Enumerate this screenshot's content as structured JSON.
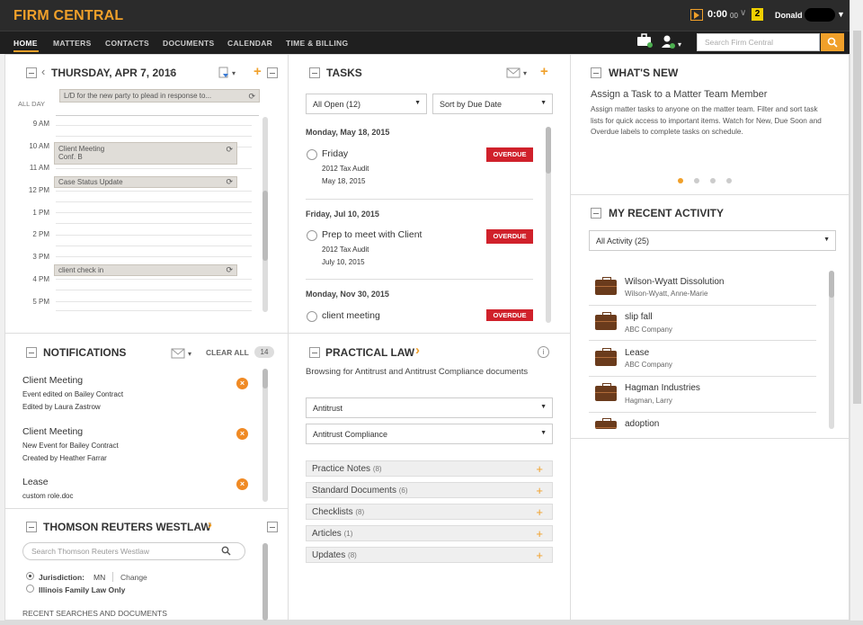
{
  "brand": "FIRM CENTRAL",
  "topbar": {
    "timer": "0:00",
    "timer_seconds": "00",
    "timer_caret": "∨",
    "notification_count": "2",
    "user": "Donald"
  },
  "nav": {
    "items": [
      "HOME",
      "MATTERS",
      "CONTACTS",
      "DOCUMENTS",
      "CALENDAR",
      "TIME & BILLING"
    ]
  },
  "search": {
    "placeholder": "Search Firm Central"
  },
  "calendar": {
    "date": "THURSDAY, APR 7, 2016",
    "all_day_label": "ALL DAY",
    "all_day_event": "L/D for the new party to plead in response to...",
    "hours": [
      "9 AM",
      "10 AM",
      "11 AM",
      "12 PM",
      "1 PM",
      "2 PM",
      "3 PM",
      "4 PM",
      "5 PM"
    ],
    "events": [
      {
        "title": "Client Meeting",
        "sub": "Conf. B"
      },
      {
        "title": "Case Status Update",
        "sub": ""
      },
      {
        "title": "client check in",
        "sub": ""
      }
    ]
  },
  "tasks": {
    "title": "TASKS",
    "filter": "All Open (12)",
    "sort": "Sort by Due Date",
    "groups": [
      {
        "date": "Monday, May 18, 2015",
        "name": "Friday",
        "matter": "2012 Tax Audit",
        "due": "May 18, 2015",
        "status": "OVERDUE"
      },
      {
        "date": "Friday, Jul 10, 2015",
        "name": "Prep to meet with Client",
        "matter": "2012 Tax Audit",
        "due": "July 10, 2015",
        "status": "OVERDUE"
      },
      {
        "date": "Monday, Nov 30, 2015",
        "name": "client meeting",
        "matter": "",
        "due": "",
        "status": "OVERDUE"
      }
    ]
  },
  "whats_new": {
    "title": "WHAT'S NEW",
    "headline": "Assign a Task to a Matter Team Member",
    "body": "Assign matter tasks to anyone on the matter team. Filter and sort task lists for quick access to important items. Watch for New, Due Soon and Overdue labels to complete tasks on schedule."
  },
  "recent_activity": {
    "title": "MY RECENT ACTIVITY",
    "filter": "All Activity (25)",
    "items": [
      {
        "title": "Wilson-Wyatt Dissolution",
        "sub": "Wilson-Wyatt, Anne-Marie"
      },
      {
        "title": "slip fall",
        "sub": "ABC Company"
      },
      {
        "title": "Lease",
        "sub": "ABC Company"
      },
      {
        "title": "Hagman Industries",
        "sub": "Hagman, Larry"
      },
      {
        "title": "adoption",
        "sub": ""
      }
    ]
  },
  "notifications": {
    "title": "NOTIFICATIONS",
    "clear_all": "CLEAR ALL",
    "count": "14",
    "items": [
      {
        "title": "Client Meeting",
        "line1": "Event edited on Bailey Contract",
        "line2": "Edited by Laura Zastrow"
      },
      {
        "title": "Client Meeting",
        "line1": "New Event for Bailey Contract",
        "line2": "Created by Heather Farrar"
      },
      {
        "title": "Lease",
        "line1": "custom role.doc",
        "line2": ""
      }
    ]
  },
  "practical_law": {
    "title": "PRACTICAL LAW",
    "browsing": "Browsing for Antitrust and Antitrust Compliance documents",
    "select1": "Antitrust",
    "select2": "Antitrust Compliance",
    "rows": [
      {
        "label": "Practice Notes",
        "count": "(8)"
      },
      {
        "label": "Standard Documents",
        "count": "(6)"
      },
      {
        "label": "Checklists",
        "count": "(8)"
      },
      {
        "label": "Articles",
        "count": "(1)"
      },
      {
        "label": "Updates",
        "count": "(8)"
      }
    ]
  },
  "westlaw": {
    "title": "THOMSON REUTERS WESTLAW",
    "search_placeholder": "Search Thomson Reuters Westlaw",
    "jurisdiction_label": "Jurisdiction:",
    "jurisdiction_value": "MN",
    "change": "Change",
    "illinois": "Illinois Family Law Only",
    "recent": "RECENT SEARCHES AND DOCUMENTS"
  }
}
